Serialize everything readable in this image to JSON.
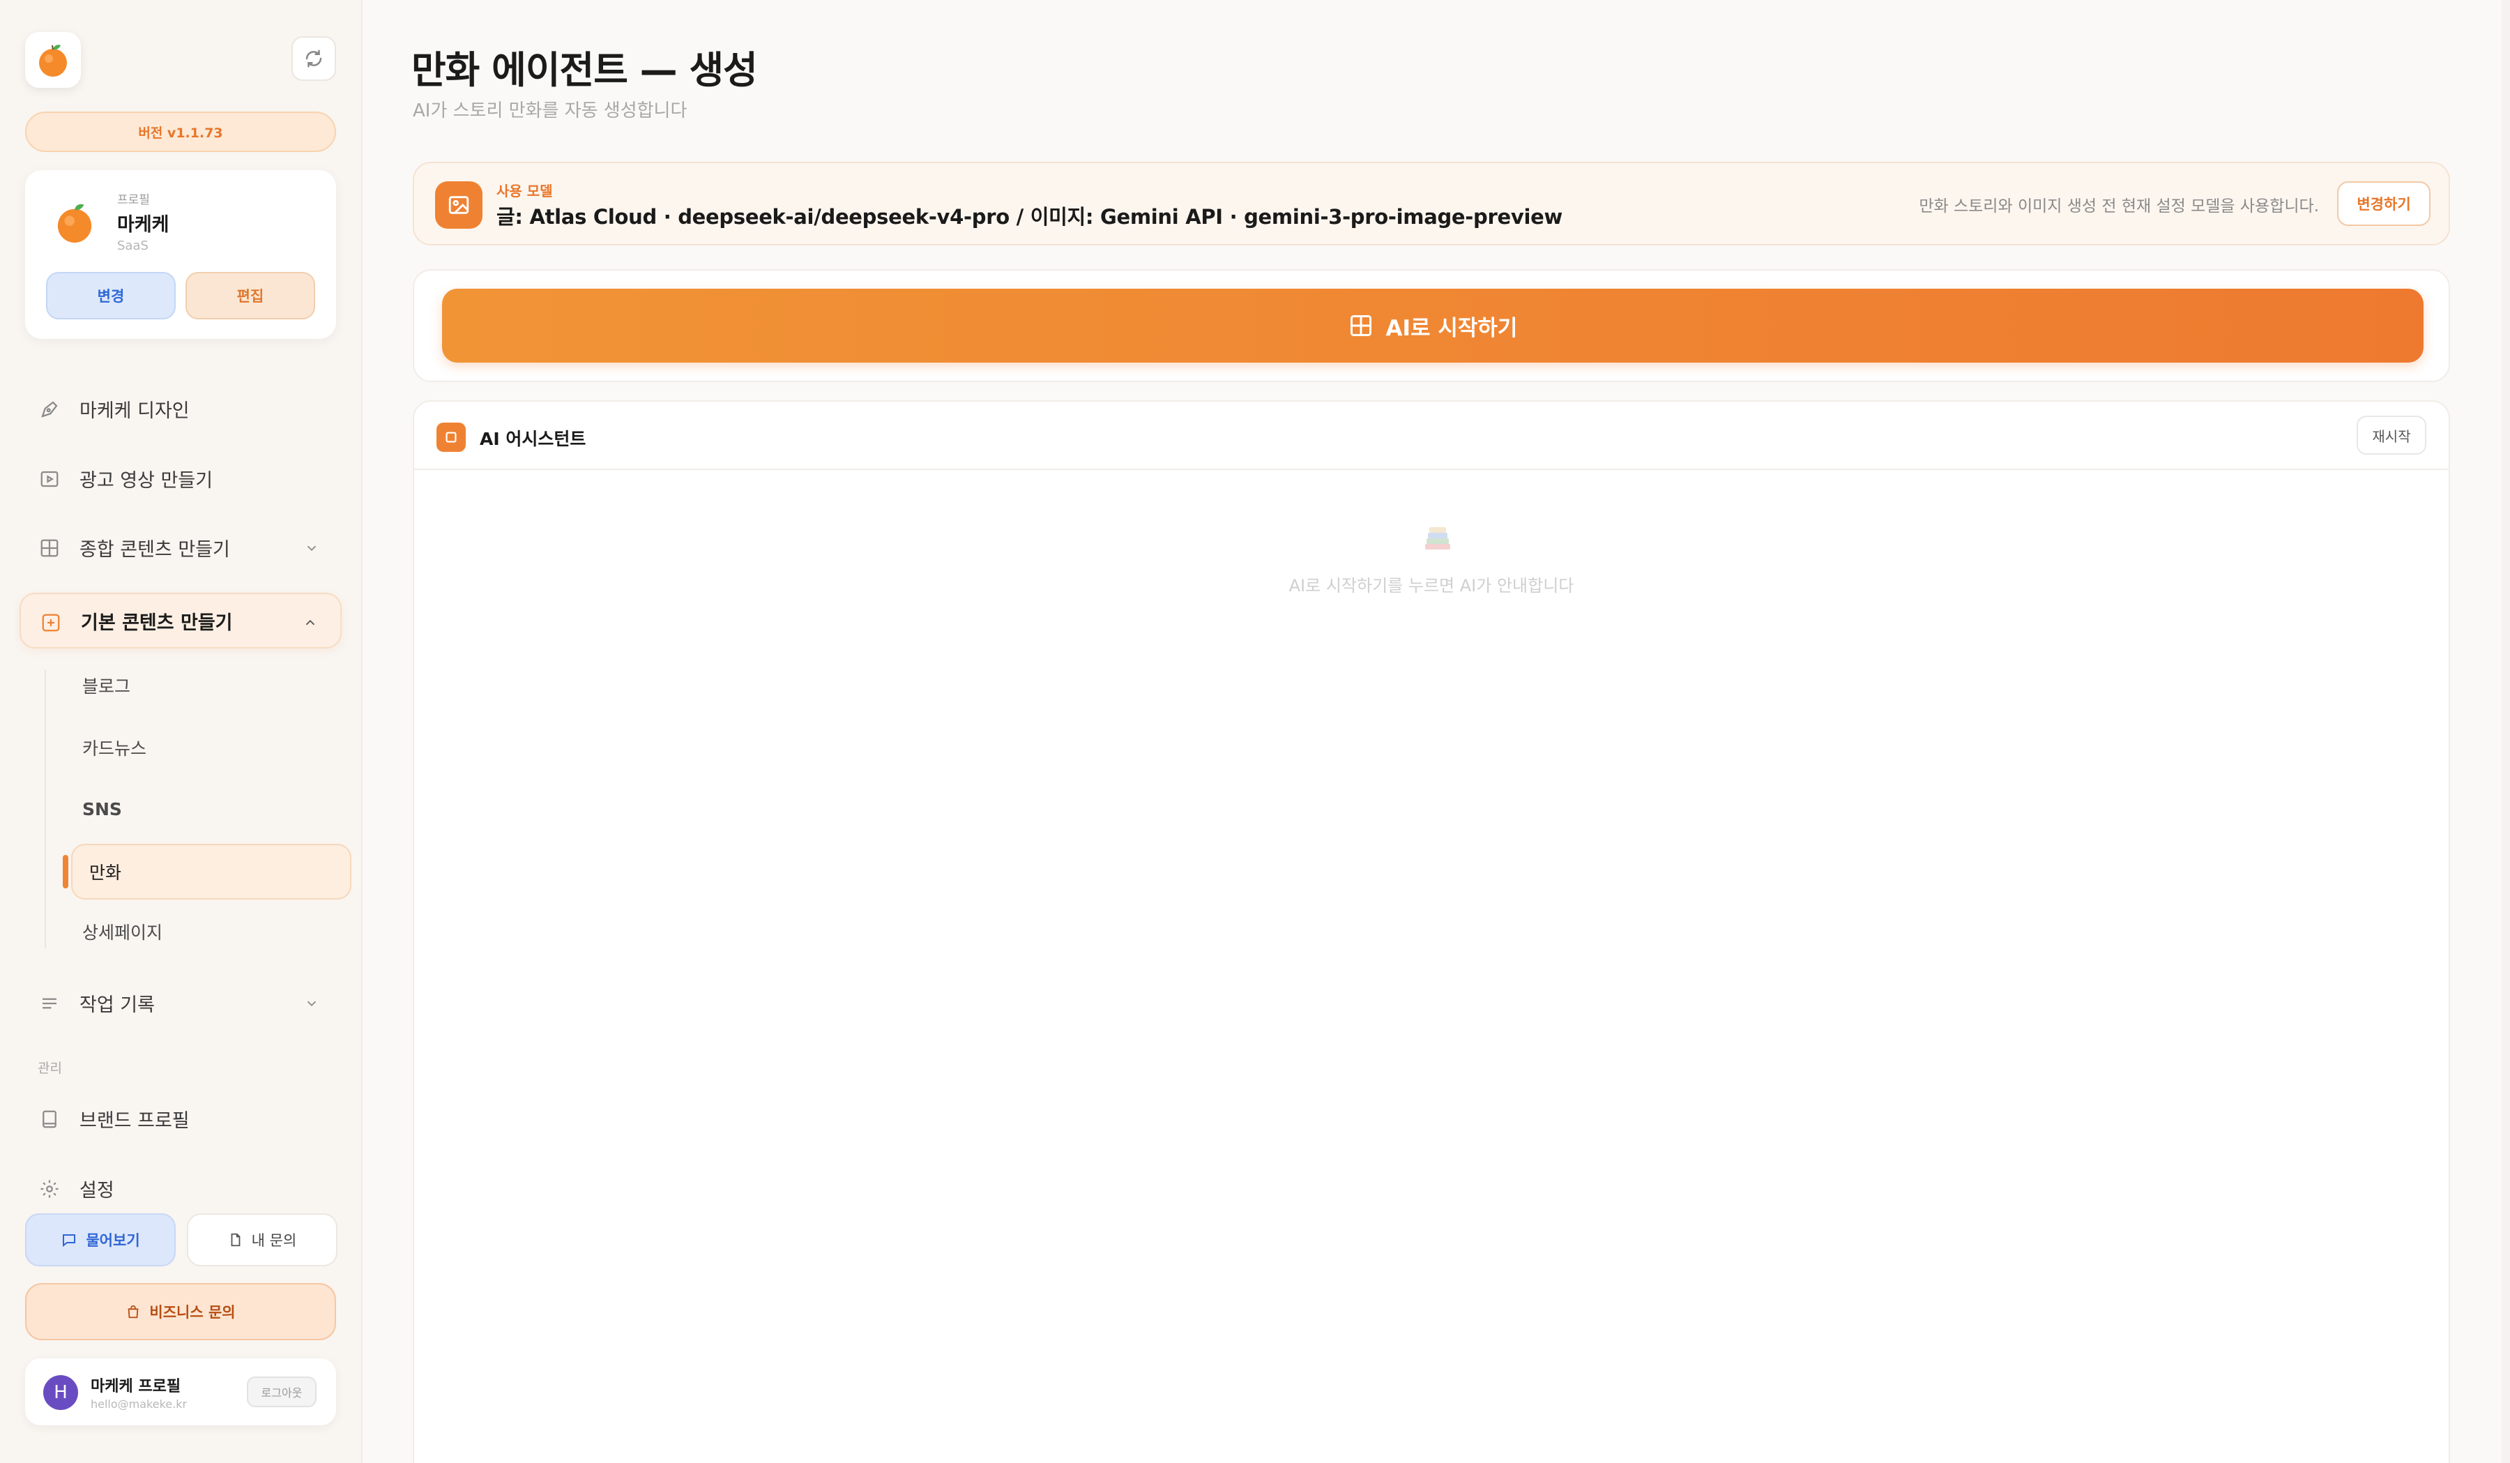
{
  "app": {
    "version": "버전 v1.1.73"
  },
  "profile": {
    "label": "프로필",
    "name": "마케케",
    "type": "SaaS",
    "change_label": "변경",
    "edit_label": "편집"
  },
  "nav": {
    "items": [
      {
        "label": "마케케 디자인",
        "icon": "pen-tool-icon"
      },
      {
        "label": "광고 영상 만들기",
        "icon": "video-play-icon"
      },
      {
        "label": "종합 콘텐츠 만들기",
        "icon": "grid-icon"
      },
      {
        "label": "기본 콘텐츠 만들기",
        "icon": "plus-square-icon"
      },
      {
        "label": "작업 기록",
        "icon": "list-icon"
      },
      {
        "label": "브랜드 프로필",
        "icon": "book-icon"
      },
      {
        "label": "설정",
        "icon": "gear-icon"
      }
    ],
    "sub_items": [
      "블로그",
      "카드뉴스",
      "SNS",
      "만화",
      "상세페이지"
    ],
    "active_sub": "만화",
    "section_admin": "관리"
  },
  "help": {
    "ask_label": "물어보기",
    "mine_label": "내 문의",
    "biz_label": "비즈니스 문의"
  },
  "user": {
    "initial": "H",
    "name": "마케케 프로필",
    "email": "hello@makeke.kr",
    "logout_label": "로그아웃"
  },
  "main": {
    "title": "만화 에이전트 — 생성",
    "subtitle": "AI가 스토리 만화를 자동 생성합니다",
    "model": {
      "label": "사용 모델",
      "value": "글: Atlas Cloud · deepseek-ai/deepseek-v4-pro / 이미지: Gemini API · gemini-3-pro-image-preview",
      "note": "만화 스토리와 이미지 생성 전 현재 설정 모델을 사용합니다.",
      "change_label": "변경하기"
    },
    "start_label": "AI로 시작하기",
    "assistant": {
      "title": "AI 어시스턴트",
      "restart_label": "재시작",
      "empty_text": "AI로 시작하기를 누르면 AI가 안내합니다"
    }
  },
  "colors": {
    "accent": "#ef8232",
    "blue": "#2e68d6",
    "sidebar_bg": "#f9f5f1"
  }
}
